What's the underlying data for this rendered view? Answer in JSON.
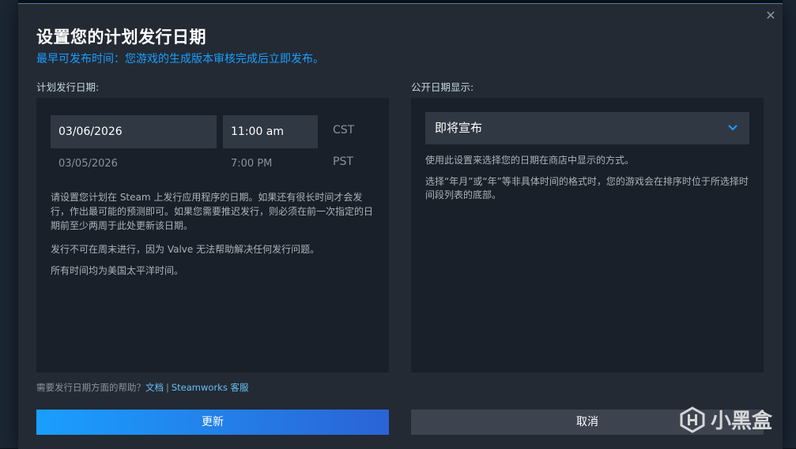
{
  "dialog": {
    "title": "设置您的计划发行日期",
    "subtitle": "最早可发布时间：您游戏的生成版本审核完成后立即发布。",
    "close_glyph": "✕"
  },
  "left": {
    "label": "计划发行日期:",
    "date": "03/06/2026",
    "time": "11:00 am",
    "tz_primary": "CST",
    "alt_date": "03/05/2026",
    "alt_time": "7:00 PM",
    "tz_alt": "PST",
    "paragraphs": [
      "请设置您计划在 Steam 上发行应用程序的日期。如果还有很长时间才会发行，作出最可能的预测即可。如果您需要推迟发行，则必须在前一次指定的日期前至少两周于此处更新该日期。",
      "发行不可在周末进行，因为 Valve 无法帮助解决任何发行问题。",
      "所有时间均为美国太平洋时间。"
    ]
  },
  "right": {
    "label": "公开日期显示:",
    "selected": "即将宣布",
    "paragraphs": [
      "使用此设置来选择您的日期在商店中显示的方式。",
      "选择“年月”或“年”等非具体时间的格式时，您的游戏会在排序时位于所选择时间段列表的底部。"
    ]
  },
  "help": {
    "text": "需要发行日期方面的帮助？",
    "link_docs": "文档",
    "separator": "|",
    "link_support": "Steamworks 客服"
  },
  "buttons": {
    "confirm": "更新",
    "cancel": "取消"
  },
  "watermark": {
    "text": "小黑盒",
    "icon": "heybox-logo-icon"
  },
  "colors": {
    "accent": "#1a9fff",
    "link": "#66c0f4",
    "modal_bg": "#232a34",
    "panel_bg": "#1a2029"
  }
}
